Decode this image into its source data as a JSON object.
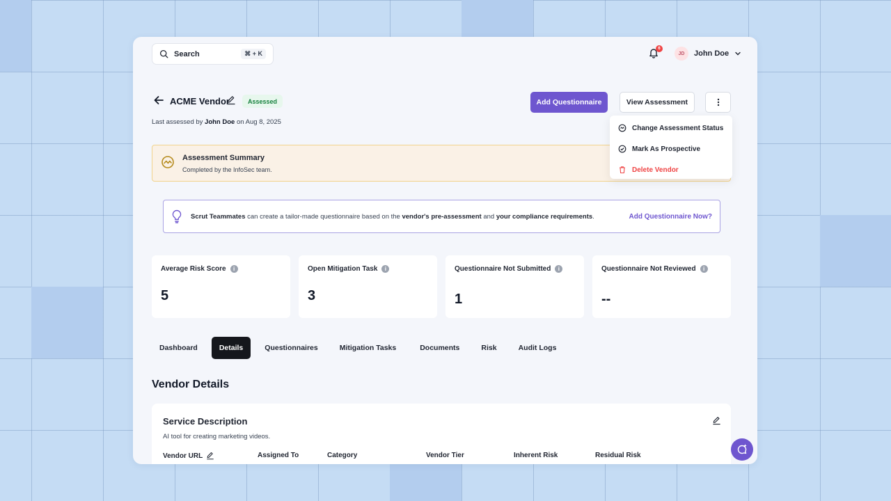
{
  "search": {
    "label": "Search",
    "shortcut": "⌘ + K"
  },
  "header": {
    "notification_count": "6",
    "user_initials": "JD",
    "user_name": "John Doe"
  },
  "vendor": {
    "name": "ACME Vendor",
    "status": "Assessed",
    "last_assessed_prefix": "Last assessed by",
    "last_assessed_by": "John Doe",
    "last_assessed_suffix": "on Aug 8, 2025"
  },
  "actions": {
    "add_questionnaire": "Add Questionnaire",
    "view_assessment": "View Assessment"
  },
  "menu": {
    "items": [
      {
        "label": "Change Assessment Status"
      },
      {
        "label": "Mark As Prospective"
      },
      {
        "label": "Delete Vendor"
      }
    ]
  },
  "summary": {
    "title": "Assessment Summary",
    "subtitle": "Completed by the InfoSec team."
  },
  "hint": {
    "bold1": "Scrut Teammates",
    "text1": " can create a tailor-made questionnaire based on the ",
    "bold2": "vendor's pre-assessment",
    "text2": " and ",
    "bold3": "your compliance requirements",
    "text3": ".",
    "cta": "Add Questionnaire Now?"
  },
  "stats": [
    {
      "title": "Average Risk Score",
      "value": "5"
    },
    {
      "title": "Open Mitigation Task",
      "value": "3"
    },
    {
      "title": "Questionnaire Not Submitted",
      "value": "1"
    },
    {
      "title": "Questionnaire Not Reviewed",
      "value": "--"
    }
  ],
  "tabs": [
    "Dashboard",
    "Details",
    "Questionnaires",
    "Mitigation Tasks",
    "Documents",
    "Risk",
    "Audit Logs"
  ],
  "details": {
    "section_title": "Vendor Details",
    "card_title": "Service Description",
    "description": "AI tool for creating marketing videos.",
    "columns": [
      "Vendor URL",
      "Assigned To",
      "Category",
      "Vendor Tier",
      "Inherent Risk",
      "Residual Risk"
    ]
  },
  "colors": {
    "accent": "#6e56cf",
    "success": "#15803d",
    "danger": "#ef4444",
    "background": "#c5dcf4"
  }
}
